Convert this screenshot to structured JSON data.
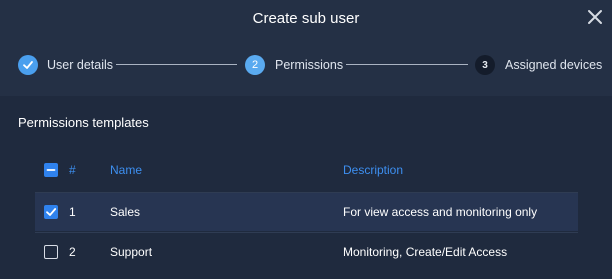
{
  "dialog": {
    "title": "Create sub user",
    "close_icon": "close-icon"
  },
  "stepper": {
    "steps": [
      {
        "number": "",
        "label": "User details",
        "state": "completed",
        "icon": "check-icon"
      },
      {
        "number": "2",
        "label": "Permissions",
        "state": "active"
      },
      {
        "number": "3",
        "label": "Assigned devices",
        "state": "upcoming"
      }
    ]
  },
  "permissions": {
    "section_title": "Permissions templates",
    "columns": [
      "#",
      "Name",
      "Description"
    ],
    "select_all_state": "indeterminate",
    "rows": [
      {
        "num": "1",
        "name": "Sales",
        "description": "For view access and monitoring only",
        "checked": true
      },
      {
        "num": "2",
        "name": "Support",
        "description": "Monitoring, Create/Edit Access",
        "checked": false
      }
    ]
  },
  "colors": {
    "accent": "#3d8ff0",
    "step_active": "#5aaaf0",
    "background": "#1f2a3e",
    "header": "#243045"
  }
}
